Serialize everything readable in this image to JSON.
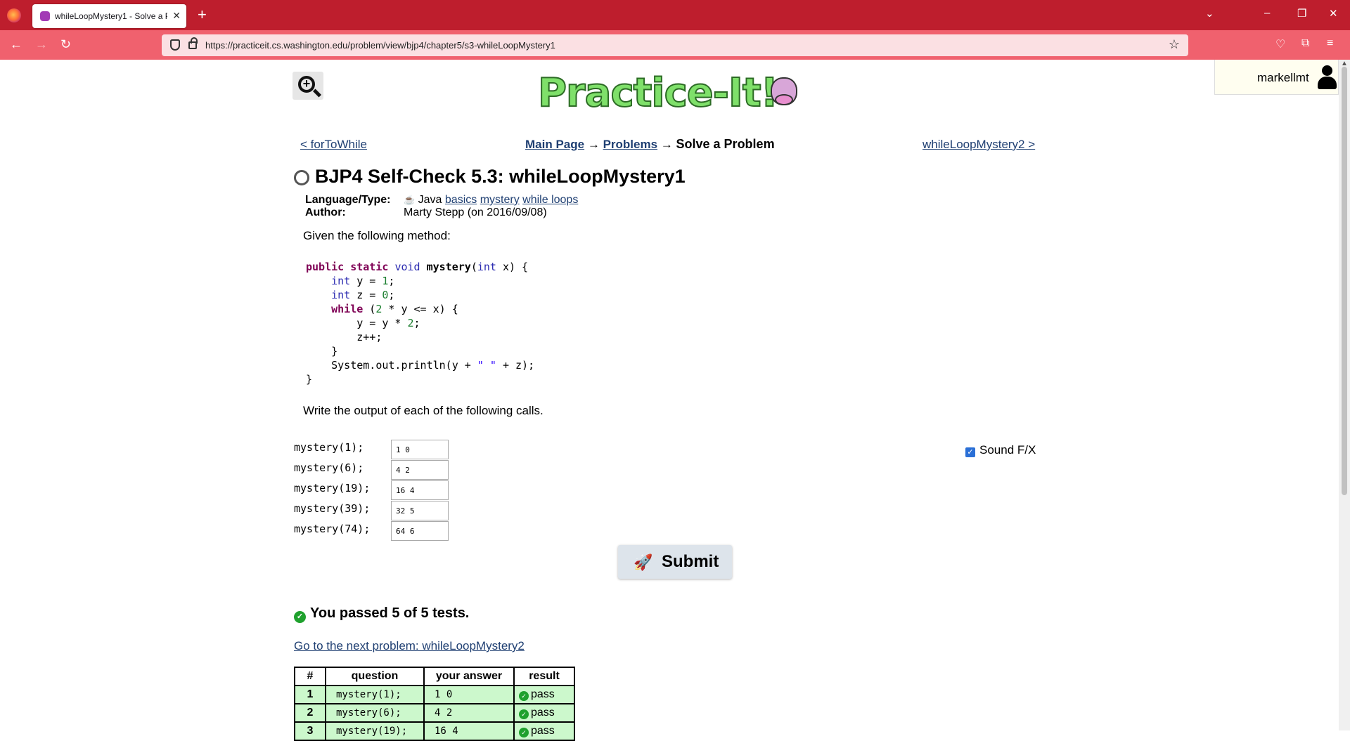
{
  "browser": {
    "tab_title": "whileLoopMystery1 - Solve a Pr",
    "url": "https://practiceit.cs.washington.edu/problem/view/bjp4/chapter5/s3-whileLoopMystery1"
  },
  "header": {
    "logo_text": "Practice-It!",
    "username": "markellmt"
  },
  "nav": {
    "prev": "< forToWhile",
    "main_page": "Main Page",
    "arrow": "→",
    "problems": "Problems",
    "current": "Solve a Problem",
    "next": "whileLoopMystery2 >"
  },
  "problem": {
    "title": "BJP4 Self-Check 5.3: whileLoopMystery1",
    "language_label": "Language/Type:",
    "language": "Java",
    "tags": [
      "basics",
      "mystery",
      "while loops"
    ],
    "author_label": "Author:",
    "author": "Marty Stepp (on 2016/09/08)",
    "given": "Given the following method:",
    "instructions": "Write the output of each of the following calls."
  },
  "calls": [
    {
      "call": "mystery(1);",
      "answer": "1 0"
    },
    {
      "call": "mystery(6);",
      "answer": "4 2"
    },
    {
      "call": "mystery(19);",
      "answer": "16 4"
    },
    {
      "call": "mystery(39);",
      "answer": "32 5"
    },
    {
      "call": "mystery(74);",
      "answer": "64 6"
    }
  ],
  "sound_fx": {
    "label": "Sound F/X",
    "checked": true
  },
  "submit_label": "Submit",
  "result": {
    "summary": "You passed 5 of 5 tests.",
    "next_link": "Go to the next problem: whileLoopMystery2",
    "columns": [
      "#",
      "question",
      "your answer",
      "result"
    ],
    "rows": [
      {
        "n": "1",
        "question": "mystery(1);",
        "answer": "1 0",
        "result": "pass"
      },
      {
        "n": "2",
        "question": "mystery(6);",
        "answer": "4 2",
        "result": "pass"
      },
      {
        "n": "3",
        "question": "mystery(19);",
        "answer": "16 4",
        "result": "pass"
      }
    ]
  }
}
